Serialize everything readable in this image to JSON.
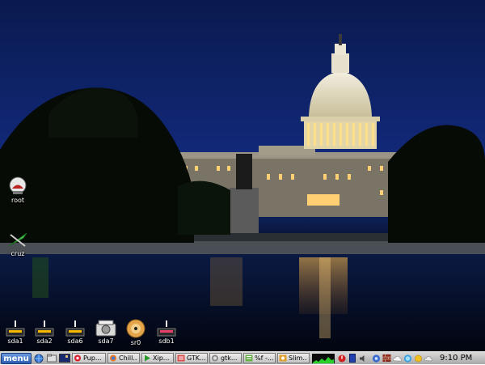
{
  "desktop": {
    "wallpaper": "US Capitol at night",
    "icons_left": [
      {
        "id": "root",
        "label": "root",
        "icon": "drive-icon"
      },
      {
        "id": "cruz",
        "label": "cruz",
        "icon": "kayak-icon"
      }
    ],
    "drives": [
      {
        "id": "sda1",
        "label": "sda1",
        "icon": "hard-drive-icon"
      },
      {
        "id": "sda2",
        "label": "sda2",
        "icon": "hard-drive-icon"
      },
      {
        "id": "sda6",
        "label": "sda6",
        "icon": "hard-drive-icon"
      },
      {
        "id": "sda7",
        "label": "sda7",
        "icon": "hard-drive-icon"
      },
      {
        "id": "sr0",
        "label": "sr0",
        "icon": "optical-disc-icon"
      },
      {
        "id": "sdb1",
        "label": "sdb1",
        "icon": "usb-drive-icon"
      }
    ]
  },
  "taskbar": {
    "menu_label": "menu",
    "tasks": [
      {
        "label": "Pup...",
        "icon": "puppy-icon"
      },
      {
        "label": "Chill...",
        "icon": "browser-icon"
      },
      {
        "label": "Xip...",
        "icon": "play-icon"
      },
      {
        "label": "GTK...",
        "icon": "gtk-icon"
      },
      {
        "label": "gtk...",
        "icon": "gtk-dialog-icon"
      },
      {
        "label": "%f -...",
        "icon": "editor-icon"
      },
      {
        "label": "Slim...",
        "icon": "slim-icon"
      }
    ],
    "clock": "9:10 PM"
  },
  "colors": {
    "sky": "#12297a",
    "taskbar": "#bdbdbd",
    "menu": "#3a6cc0",
    "light": "#ffd27a"
  }
}
